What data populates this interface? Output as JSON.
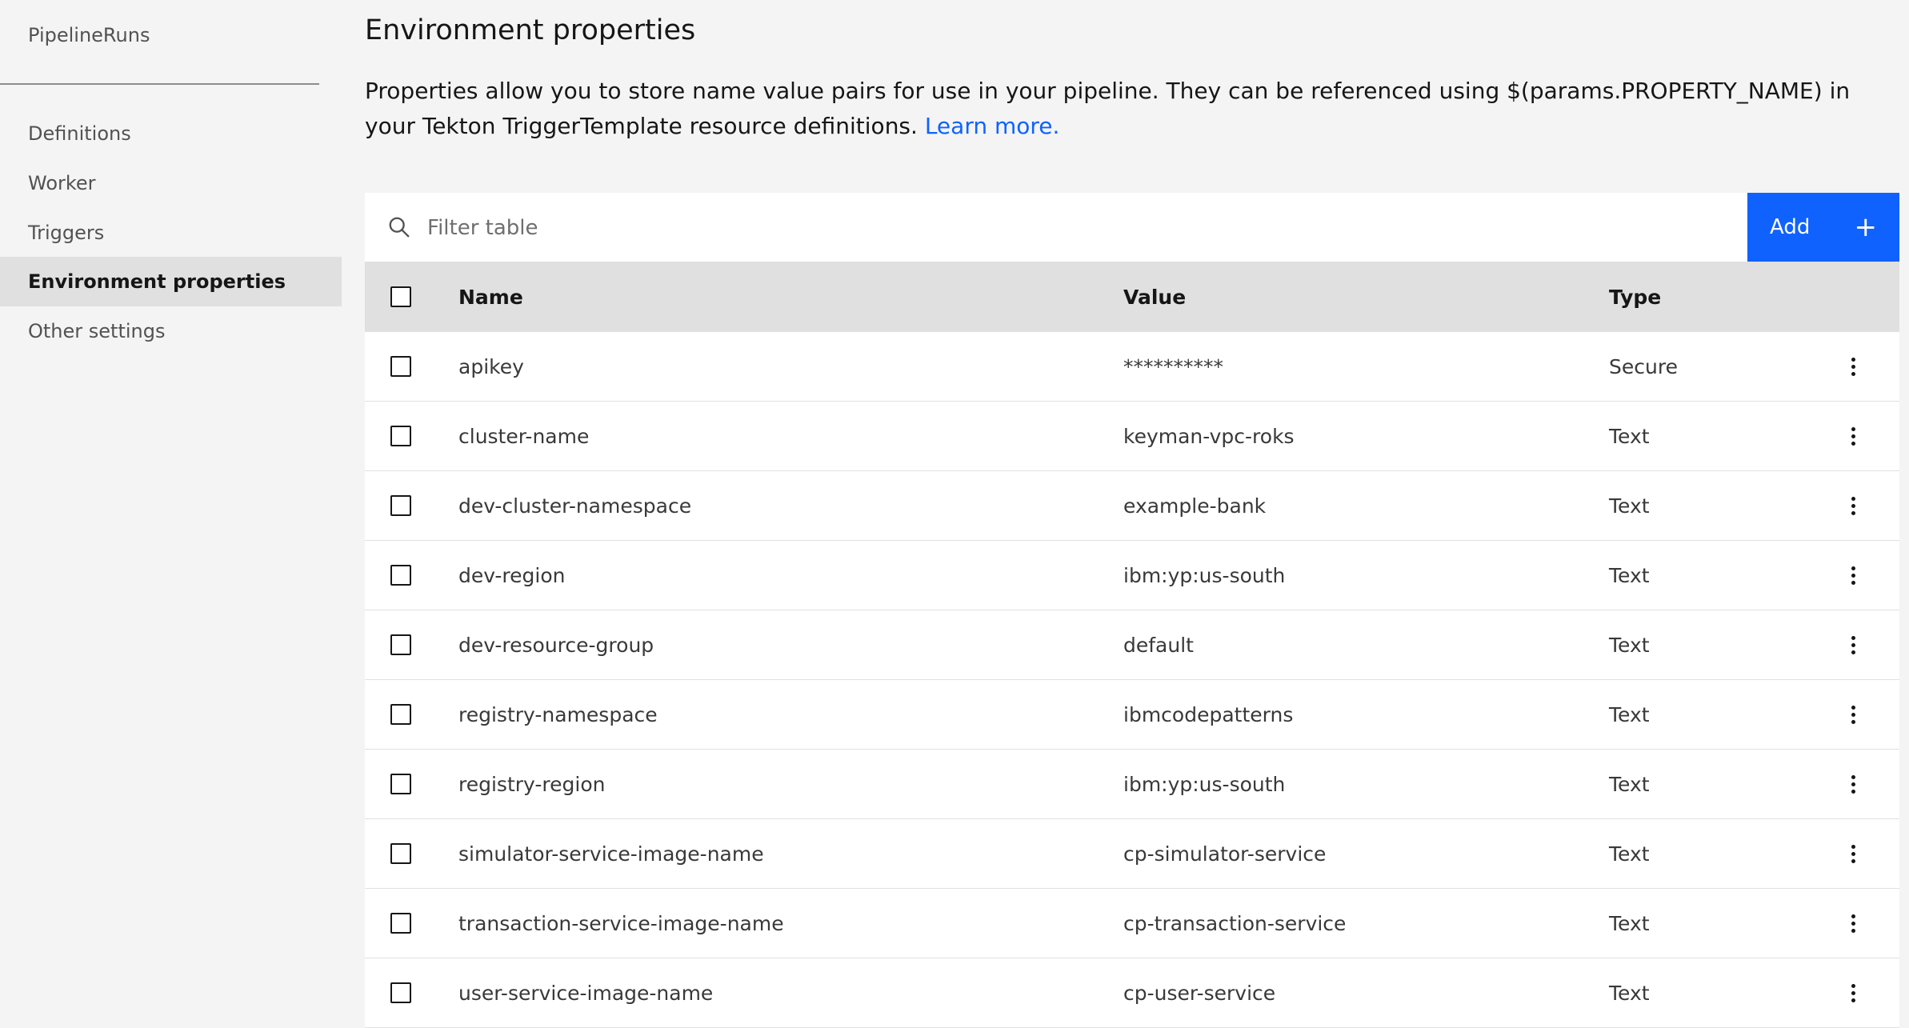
{
  "sidebar": {
    "title": "PipelineRuns",
    "items": [
      {
        "label": "Definitions",
        "active": false
      },
      {
        "label": "Worker",
        "active": false
      },
      {
        "label": "Triggers",
        "active": false
      },
      {
        "label": "Environment properties",
        "active": true
      },
      {
        "label": "Other settings",
        "active": false
      }
    ]
  },
  "main": {
    "title": "Environment properties",
    "description": "Properties allow you to store name value pairs for use in your pipeline. They can be referenced using $(params.PROPERTY_NAME) in your Tekton TriggerTemplate resource definitions.",
    "learn_more": "Learn more."
  },
  "toolbar": {
    "filter_placeholder": "Filter table",
    "add_label": "Add"
  },
  "table": {
    "headers": {
      "name": "Name",
      "value": "Value",
      "type": "Type"
    },
    "rows": [
      {
        "name": "apikey",
        "value": "**********",
        "type": "Secure"
      },
      {
        "name": "cluster-name",
        "value": "keyman-vpc-roks",
        "type": "Text"
      },
      {
        "name": "dev-cluster-namespace",
        "value": "example-bank",
        "type": "Text"
      },
      {
        "name": "dev-region",
        "value": "ibm:yp:us-south",
        "type": "Text"
      },
      {
        "name": "dev-resource-group",
        "value": "default",
        "type": "Text"
      },
      {
        "name": "registry-namespace",
        "value": "ibmcodepatterns",
        "type": "Text"
      },
      {
        "name": "registry-region",
        "value": "ibm:yp:us-south",
        "type": "Text"
      },
      {
        "name": "simulator-service-image-name",
        "value": "cp-simulator-service",
        "type": "Text"
      },
      {
        "name": "transaction-service-image-name",
        "value": "cp-transaction-service",
        "type": "Text"
      },
      {
        "name": "user-service-image-name",
        "value": "cp-user-service",
        "type": "Text"
      }
    ]
  },
  "colors": {
    "accent": "#0f62fe",
    "background": "#f4f4f4",
    "header_row": "#e0e0e0"
  },
  "icons": {
    "search": "search-icon",
    "add": "plus-icon",
    "row_menu": "overflow-menu-icon"
  }
}
